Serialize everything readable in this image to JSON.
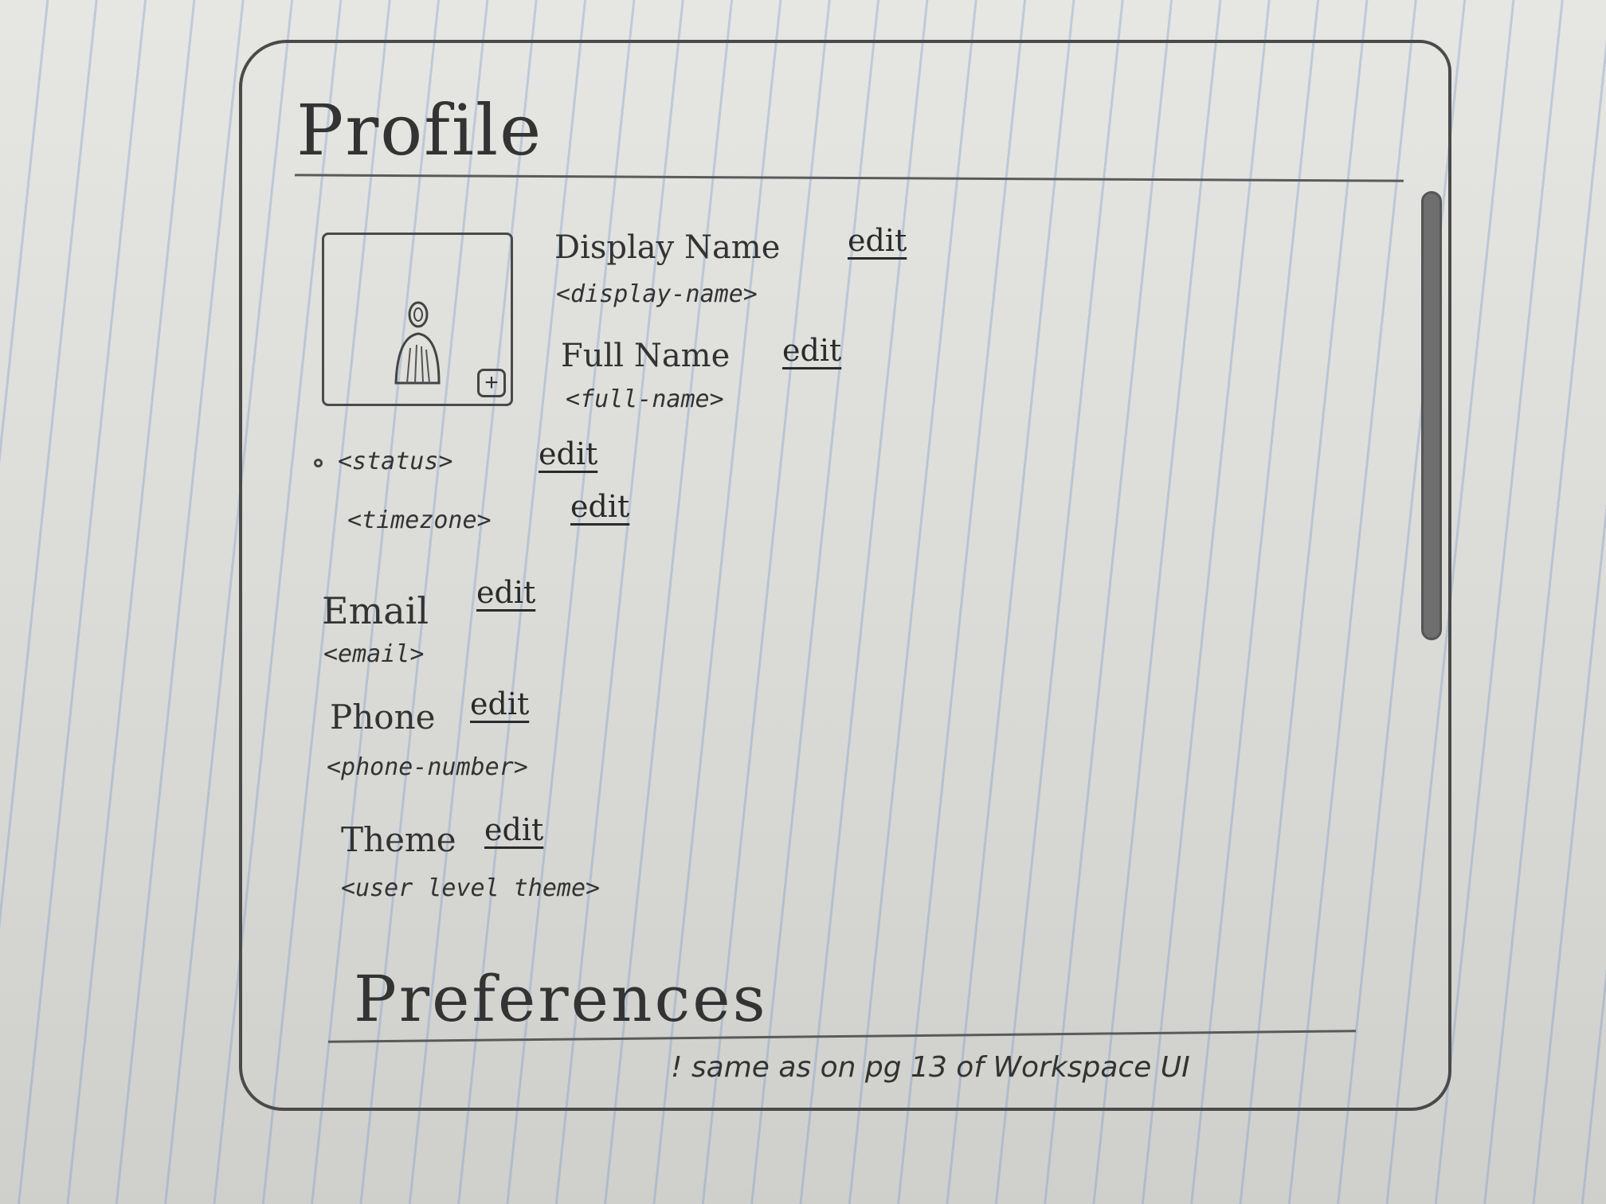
{
  "profile": {
    "title": "Profile",
    "avatar": {
      "icon": "person-icon",
      "add_label": "+"
    },
    "display_name": {
      "label": "Display Name",
      "edit": "edit",
      "value": "<display-name>"
    },
    "full_name": {
      "label": "Full Name",
      "edit": "edit",
      "value": "<full-name>"
    },
    "status": {
      "value": "<status>",
      "edit": "edit"
    },
    "timezone": {
      "value": "<timezone>",
      "edit": "edit"
    },
    "email": {
      "label": "Email",
      "edit": "edit",
      "value": "<email>"
    },
    "phone": {
      "label": "Phone",
      "edit": "edit",
      "value": "<phone-number>"
    },
    "theme": {
      "label": "Theme",
      "edit": "edit",
      "value": "<user level theme>"
    }
  },
  "preferences": {
    "title": "Preferences",
    "note": "! same as on pg 13 of Workspace UI"
  }
}
